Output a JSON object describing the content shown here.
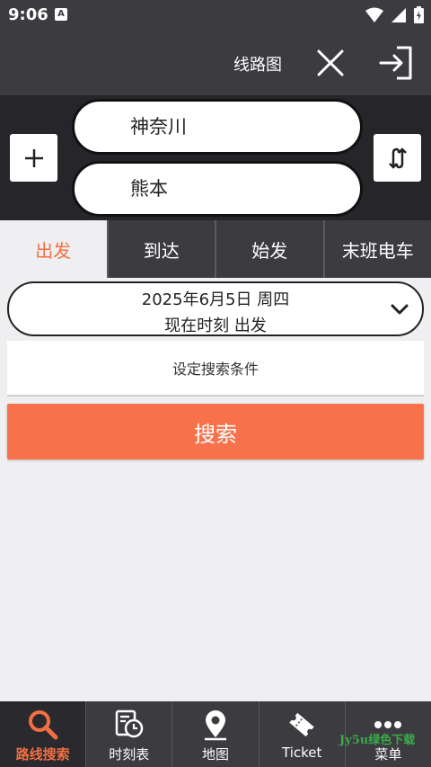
{
  "status_bar": {
    "time": "9:06",
    "badge": "A"
  },
  "header": {
    "title": "线路图"
  },
  "route": {
    "from": "神奈川",
    "to": "熊本"
  },
  "tabs": [
    {
      "label": "出发",
      "active": true
    },
    {
      "label": "到达"
    },
    {
      "label": "始发"
    },
    {
      "label": "末班电车"
    }
  ],
  "datetime": {
    "date": "2025年6月5日 周四",
    "time": "现在时刻 出发"
  },
  "conditions": {
    "label": "设定搜索条件"
  },
  "search": {
    "label": "搜索"
  },
  "nav": [
    {
      "label": "路线搜索",
      "icon": "search-icon",
      "active": true
    },
    {
      "label": "时刻表",
      "icon": "timetable-icon"
    },
    {
      "label": "地图",
      "icon": "map-pin-icon"
    },
    {
      "label": "Ticket",
      "icon": "ticket-icon"
    },
    {
      "label": "菜单",
      "icon": "more-icon"
    }
  ],
  "watermark": "Jy5u绿色下载",
  "colors": {
    "accent": "#f7714a",
    "header": "#3c3c40",
    "panel": "#26262a"
  }
}
